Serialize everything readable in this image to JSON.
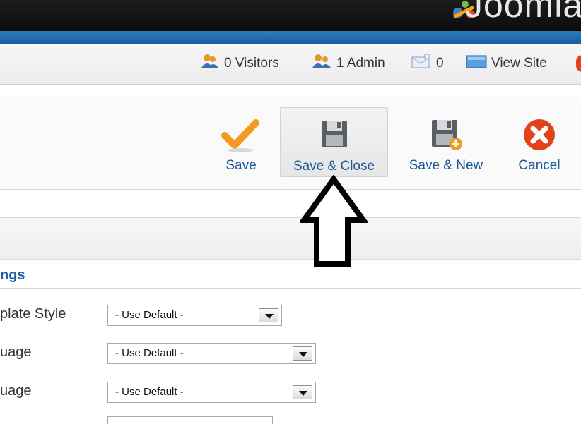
{
  "header": {
    "logo_text": "Joomla!"
  },
  "status": {
    "visitors": "0 Visitors",
    "admin": "1 Admin",
    "messages": "0",
    "view_site": "View Site"
  },
  "toolbar": {
    "save": "Save",
    "save_close": "Save & Close",
    "save_new": "Save & New",
    "cancel": "Cancel"
  },
  "section": {
    "title": "ngs"
  },
  "fields": {
    "template_style_label": "plate Style",
    "template_style_value": "- Use Default -",
    "language1_label": "uage",
    "language1_value": "- Use Default -",
    "language2_label": "uage",
    "language2_value": "- Use Default -"
  },
  "colors": {
    "accent_blue": "#1e5fa3",
    "save_orange": "#f29a1f",
    "cancel_red": "#e2421b",
    "topbar": "#111111",
    "strip_blue": "#2478bd"
  }
}
